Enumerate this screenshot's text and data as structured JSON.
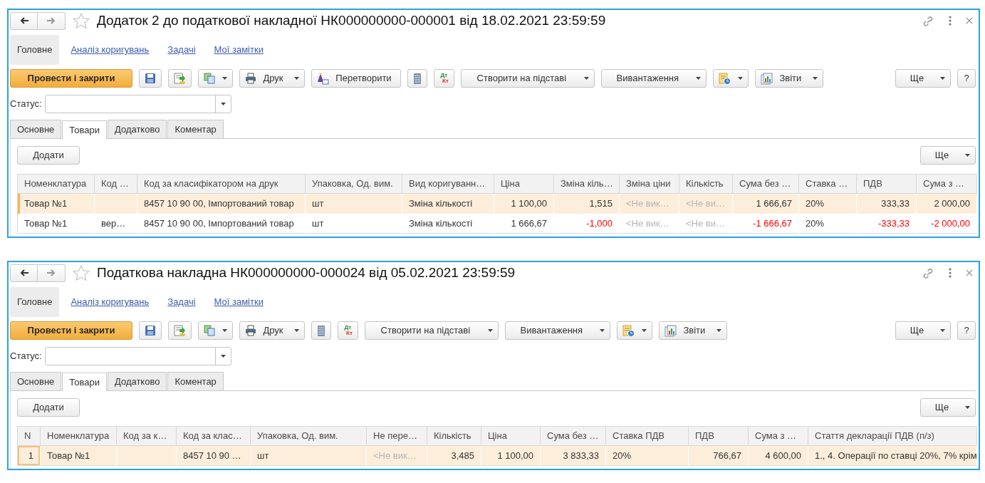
{
  "windows": [
    {
      "title": "Додаток 2 до податкової накладної НК000000000-000001 від 18.02.2021 23:59:59",
      "nav": [
        {
          "label": "Головне",
          "selected": true
        },
        {
          "label": "Аналіз коригувань",
          "selected": false
        },
        {
          "label": "Задачі",
          "selected": false
        },
        {
          "label": "Мої замітки",
          "selected": false
        }
      ],
      "toolbar": [
        {
          "kind": "primary",
          "label": "Провести і закрити",
          "dropdown": false
        },
        {
          "kind": "save",
          "dropdown": false
        },
        {
          "kind": "post",
          "dropdown": false
        },
        {
          "kind": "copy",
          "dropdown": true
        },
        {
          "kind": "print",
          "label": "Друк",
          "dropdown": true
        },
        {
          "kind": "convert",
          "label": "Перетворити",
          "dropdown": false
        },
        {
          "kind": "list",
          "dropdown": false
        },
        {
          "kind": "dtkt",
          "top": "Дт",
          "bottom": "Кт",
          "dropdown": false
        },
        {
          "kind": "text",
          "label": "Створити на підставі",
          "dropdown": true
        },
        {
          "kind": "text",
          "label": "Вивантаження",
          "dropdown": true
        },
        {
          "kind": "history",
          "dropdown": true
        },
        {
          "kind": "reports",
          "label": "Звіти",
          "dropdown": true
        }
      ],
      "toolbar_right": [
        {
          "kind": "text",
          "label": "Ще",
          "dropdown": true
        },
        {
          "kind": "text",
          "label": "?",
          "dropdown": false
        }
      ],
      "status": {
        "label": "Статус:"
      },
      "tabs": [
        {
          "label": "Основне",
          "selected": false
        },
        {
          "label": "Товари",
          "selected": true
        },
        {
          "label": "Додатково",
          "selected": false
        },
        {
          "label": "Коментар",
          "selected": false
        }
      ],
      "table_buttons": {
        "add": "Додати",
        "more": "Ще"
      },
      "table": {
        "columns": [
          "Номенклатура",
          "Код …",
          "Код за класифікатором на друк",
          "Упаковка, Од. вим.",
          "Вид коригуванн…",
          "Ціна",
          "Зміна кіль…",
          "Зміна ціни",
          "Кількість",
          "Сума без …",
          "Ставка …",
          "ПДВ",
          "Сума з …"
        ],
        "rows": [
          {
            "selected": true,
            "cells": [
              {
                "kind": "text",
                "text": "Товар №1"
              },
              {
                "kind": "empty"
              },
              {
                "kind": "text",
                "text": "8457 10 90 00, Імпортований товар"
              },
              {
                "kind": "text",
                "text": "шт"
              },
              {
                "kind": "text",
                "text": "Зміна кількості"
              },
              {
                "kind": "number",
                "text": "1 100,00"
              },
              {
                "kind": "number",
                "text": "1,515"
              },
              {
                "kind": "placeholder",
                "text": "<Не вик…"
              },
              {
                "kind": "placeholder",
                "text": "<Не ви…"
              },
              {
                "kind": "number",
                "text": "1 666,67"
              },
              {
                "kind": "text",
                "text": "20%"
              },
              {
                "kind": "number",
                "text": "333,33"
              },
              {
                "kind": "number",
                "text": "2 000,00"
              }
            ]
          },
          {
            "selected": false,
            "cells": [
              {
                "kind": "text",
                "text": "Товар №1"
              },
              {
                "kind": "text",
                "text": "вер…"
              },
              {
                "kind": "text",
                "text": "8457 10 90 00, Імпортований товар"
              },
              {
                "kind": "text",
                "text": "шт"
              },
              {
                "kind": "text",
                "text": "Зміна кількості"
              },
              {
                "kind": "number",
                "text": "1 666,67"
              },
              {
                "kind": "negative",
                "text": "-1,000"
              },
              {
                "kind": "placeholder",
                "text": "<Не вик…"
              },
              {
                "kind": "placeholder",
                "text": "<Не ви…"
              },
              {
                "kind": "negative",
                "text": "-1 666,67"
              },
              {
                "kind": "text",
                "text": "20%"
              },
              {
                "kind": "negative",
                "text": "-333,33"
              },
              {
                "kind": "negative",
                "text": "-2 000,00"
              }
            ]
          }
        ]
      }
    },
    {
      "title": "Податкова накладна НК000000000-000024 від 05.02.2021 23:59:59",
      "nav": [
        {
          "label": "Головне",
          "selected": true
        },
        {
          "label": "Аналіз коригувань",
          "selected": false
        },
        {
          "label": "Задачі",
          "selected": false
        },
        {
          "label": "Мої замітки",
          "selected": false
        }
      ],
      "toolbar": [
        {
          "kind": "primary",
          "label": "Провести і закрити",
          "dropdown": false
        },
        {
          "kind": "save",
          "dropdown": false
        },
        {
          "kind": "post",
          "dropdown": false
        },
        {
          "kind": "copy",
          "dropdown": true
        },
        {
          "kind": "print",
          "label": "Друк",
          "dropdown": true
        },
        {
          "kind": "list",
          "dropdown": false
        },
        {
          "kind": "dtkt",
          "top": "Дт",
          "bottom": "Кт",
          "dropdown": false
        },
        {
          "kind": "text",
          "label": "Створити на підставі",
          "dropdown": true
        },
        {
          "kind": "text",
          "label": "Вивантаження",
          "dropdown": true
        },
        {
          "kind": "history",
          "dropdown": true
        },
        {
          "kind": "reports",
          "label": "Звіти",
          "dropdown": true
        }
      ],
      "toolbar_right": [
        {
          "kind": "text",
          "label": "Ще",
          "dropdown": true
        },
        {
          "kind": "text",
          "label": "?",
          "dropdown": false
        }
      ],
      "status": {
        "label": "Статус:"
      },
      "tabs": [
        {
          "label": "Основне",
          "selected": false
        },
        {
          "label": "Товари",
          "selected": true
        },
        {
          "label": "Додатково",
          "selected": false
        },
        {
          "label": "Коментар",
          "selected": false
        }
      ],
      "table_buttons": {
        "add": "Додати",
        "more": "Ще"
      },
      "table": {
        "columns": [
          "N",
          "Номенклатура",
          "Код за к…",
          "Код за клас…",
          "Упаковка, Од. вим.",
          "Не пере…",
          "Кількість",
          "Ціна",
          "Сума без …",
          "Ставка ПДВ",
          "ПДВ",
          "Сума з …",
          "Стаття декларації ПДВ (п/з)"
        ],
        "rows": [
          {
            "selected": true,
            "cells": [
              {
                "kind": "index",
                "text": "1"
              },
              {
                "kind": "text",
                "text": "Товар №1"
              },
              {
                "kind": "empty"
              },
              {
                "kind": "text",
                "text": "8457 10 90 …"
              },
              {
                "kind": "text",
                "text": "шт"
              },
              {
                "kind": "placeholder",
                "text": "<Не вик…"
              },
              {
                "kind": "number",
                "text": "3,485"
              },
              {
                "kind": "number",
                "text": "1 100,00"
              },
              {
                "kind": "number",
                "text": "3 833,33"
              },
              {
                "kind": "text",
                "text": "20%"
              },
              {
                "kind": "number",
                "text": "766,67"
              },
              {
                "kind": "number",
                "text": "4 600,00"
              },
              {
                "kind": "text",
                "text": "1., 4. Операції по ставці 20%, 7% крім"
              }
            ]
          }
        ]
      }
    }
  ]
}
